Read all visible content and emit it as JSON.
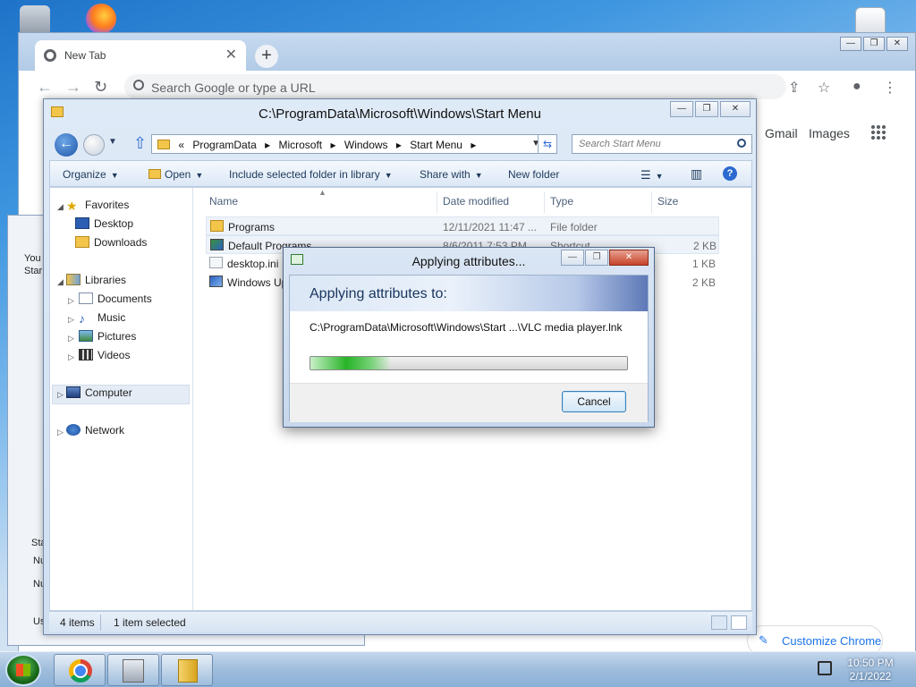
{
  "chrome": {
    "tab_title": "New Tab",
    "tab_close": "✕",
    "new_tab": "+",
    "omnibox_placeholder": "Search Google or type a URL",
    "links": {
      "gmail": "Gmail",
      "images": "Images"
    },
    "customize_label": "Customize Chrome",
    "window_controls": {
      "minimize": "—",
      "restore": "❐",
      "close": "✕"
    }
  },
  "background_window": {
    "fragments": [
      "You",
      "Star",
      "Sta",
      "Nu",
      "Nu",
      "Us"
    ]
  },
  "explorer": {
    "title": "C:\\ProgramData\\Microsoft\\Windows\\Start Menu",
    "address": {
      "overflow": "«",
      "crumbs": [
        "ProgramData",
        "Microsoft",
        "Windows",
        "Start Menu"
      ],
      "separator": "▸"
    },
    "search_placeholder": "Search Start Menu",
    "commands": {
      "organize": "Organize",
      "open": "Open",
      "include": "Include selected folder in library",
      "share": "Share with",
      "new_folder": "New folder",
      "help": "?"
    },
    "nav": {
      "favorites": "Favorites",
      "desktop": "Desktop",
      "downloads": "Downloads",
      "libraries": "Libraries",
      "documents": "Documents",
      "music": "Music",
      "pictures": "Pictures",
      "videos": "Videos",
      "computer": "Computer",
      "network": "Network"
    },
    "columns": {
      "name": "Name",
      "date": "Date modified",
      "type": "Type",
      "size": "Size"
    },
    "files": [
      {
        "name": "Programs",
        "date": "12/11/2021 11:47 ...",
        "type": "File folder",
        "size": ""
      },
      {
        "name": "Default Programs",
        "date": "8/6/2011 7:53 PM",
        "type": "Shortcut",
        "size": "2 KB"
      },
      {
        "name": "desktop.ini",
        "date": "",
        "type": "",
        "size": "1 KB"
      },
      {
        "name": "Windows Up",
        "date": "",
        "type": "",
        "size": "2 KB"
      }
    ],
    "status": {
      "count": "4 items",
      "selected": "1 item selected"
    }
  },
  "dialog": {
    "title": "Applying attributes...",
    "heading": "Applying attributes to:",
    "path": "C:\\ProgramData\\Microsoft\\Windows\\Start ...\\VLC media player.lnk",
    "progress": 0.25,
    "cancel_label": "Cancel"
  },
  "taskbar": {
    "time": "10:50 PM",
    "date": "2/1/2022"
  },
  "colors": {
    "accent_blue": "#1a73e8",
    "progress_green": "#27b427",
    "explorer_frame": "#cfdff1"
  }
}
